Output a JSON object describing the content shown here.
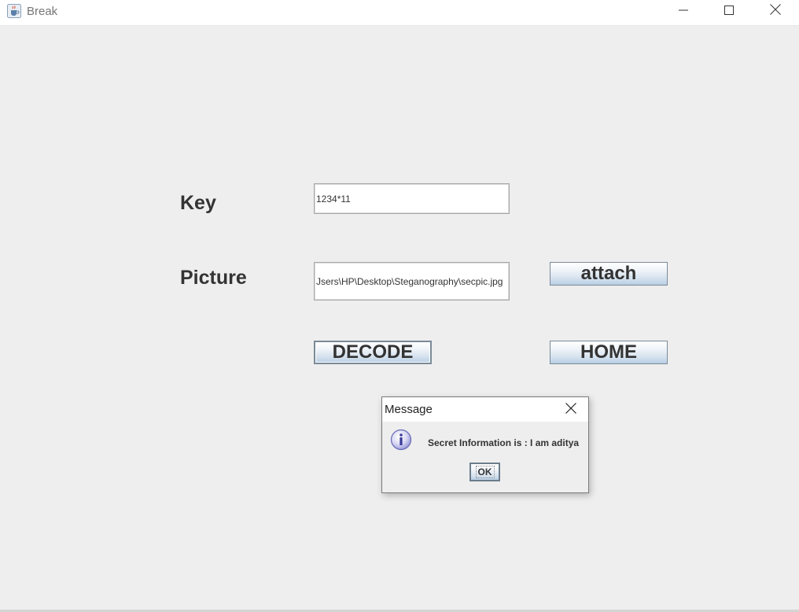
{
  "window": {
    "title": "Break",
    "icon": "java-coffee-cup-icon",
    "controls": {
      "minimize": "minimize-icon",
      "maximize": "maximize-icon",
      "close": "close-icon"
    }
  },
  "form": {
    "key_label": "Key",
    "key_value": "1234*11",
    "picture_label": "Picture",
    "picture_value": "Jsers\\HP\\Desktop\\Steganography\\secpic.jpg",
    "attach_label": "attach",
    "decode_label": "DECODE",
    "home_label": "HOME"
  },
  "dialog": {
    "title": "Message",
    "icon": "info-icon",
    "message": "Secret Information is : I am aditya",
    "ok_label": "OK"
  },
  "colors": {
    "background": "#eeeeee",
    "button_gradient_bottom": "#b8cfe5",
    "info_icon": "#8080d0"
  }
}
